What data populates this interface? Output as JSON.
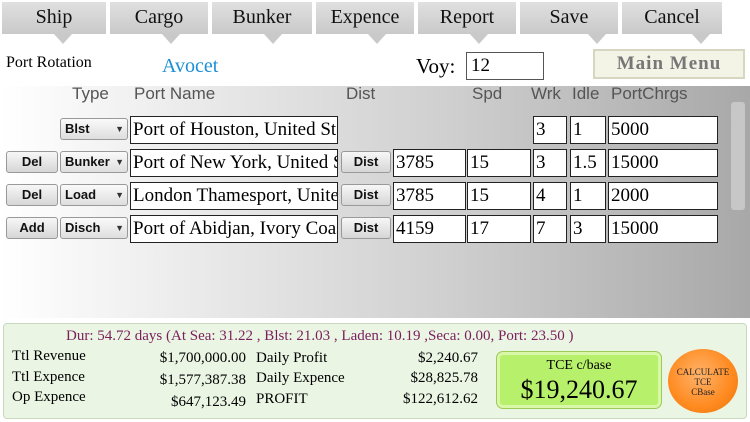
{
  "tabs": [
    "Ship",
    "Cargo",
    "Bunker",
    "Expence",
    "Report",
    "Save",
    "Cancel"
  ],
  "port_rotation_label": "Port Rotation",
  "vessel_name": "Avocet",
  "voy_label": "Voy:",
  "voy_value": "12",
  "main_menu_label": "Main Menu",
  "columns": {
    "type": "Type",
    "port_name": "Port Name",
    "dist": "Dist",
    "spd": "Spd",
    "wrk": "Wrk",
    "idle": "Idle",
    "portchrgs": "PortChrgs"
  },
  "rows": [
    {
      "action": "",
      "type": "Blst",
      "port": "Port of Houston, United States",
      "dist_btn": "",
      "dist": "",
      "spd": "",
      "wrk": "3",
      "idle": "1",
      "portchrgs": "5000"
    },
    {
      "action": "Del",
      "type": "Bunker",
      "port": "Port of New York, United States",
      "dist_btn": "Dist",
      "dist": "3785",
      "spd": "15",
      "wrk": "3",
      "idle": "1.5",
      "portchrgs": "15000"
    },
    {
      "action": "Del",
      "type": "Load",
      "port": "London Thamesport, United Kingdom",
      "dist_btn": "Dist",
      "dist": "3785",
      "spd": "15",
      "wrk": "4",
      "idle": "1",
      "portchrgs": "2000"
    },
    {
      "action": "Add",
      "type": "Disch",
      "port": "Port of Abidjan, Ivory Coast",
      "dist_btn": "Dist",
      "dist": "4159",
      "spd": "17",
      "wrk": "7",
      "idle": "3",
      "portchrgs": "15000"
    }
  ],
  "summary": {
    "duration": "Dur: 54.72 days (At Sea: 31.22 , Blst: 21.03 , Laden: 10.19 ,Seca: 0.00, Port: 23.50 )",
    "ttl_revenue_label": "Ttl Revenue",
    "ttl_revenue": "$1,700,000.00",
    "ttl_expence_label": "Ttl Expence",
    "ttl_expence": "$1,577,387.38",
    "op_expence_label": "Op Expence",
    "op_expence": "$647,123.49",
    "daily_profit_label": "Daily Profit",
    "daily_profit": "$2,240.67",
    "daily_expence_label": "Daily Expence",
    "daily_expence": "$28,825.78",
    "profit_label": "PROFIT",
    "profit": "$122,612.62",
    "tce_label": "TCE c/base",
    "tce_value": "$19,240.67",
    "calc_line1": "CALCULATE",
    "calc_line2": "TCE",
    "calc_line3": "CBase"
  }
}
